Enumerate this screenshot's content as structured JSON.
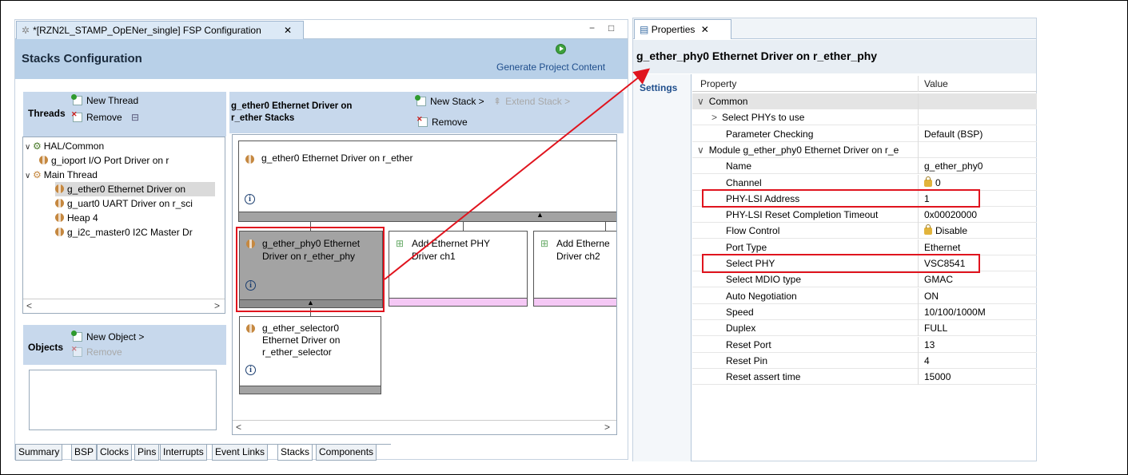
{
  "editor": {
    "tab_title": "*[RZN2L_STAMP_OpENer_single] FSP Configuration",
    "close_glyph": "✕",
    "minimize_glyph": "−",
    "maximize_glyph": "□",
    "header_title": "Stacks Configuration",
    "generate_label": "Generate Project Content"
  },
  "threads": {
    "label": "Threads",
    "new_thread": "New Thread",
    "remove": "Remove",
    "tree": [
      {
        "label": "HAL/Common",
        "level": 0,
        "expanded": true
      },
      {
        "label": "g_ioport I/O Port Driver on r",
        "level": 1
      },
      {
        "label": "Main Thread",
        "level": 0,
        "expanded": true
      },
      {
        "label": "g_ether0 Ethernet Driver on",
        "level": 1,
        "selected": true
      },
      {
        "label": "g_uart0 UART Driver on r_sci",
        "level": 1
      },
      {
        "label": "Heap 4",
        "level": 1
      },
      {
        "label": "g_i2c_master0 I2C Master Dr",
        "level": 1
      }
    ]
  },
  "objects": {
    "label": "Objects",
    "new_object": "New Object >",
    "remove": "Remove"
  },
  "stacks": {
    "title_line1": "g_ether0 Ethernet Driver on",
    "title_line2": "r_ether Stacks",
    "new_stack": "New Stack >",
    "extend_stack": "Extend Stack >",
    "remove": "Remove",
    "root_block": "g_ether0 Ethernet Driver on r_ether",
    "phy_block_line1": "g_ether_phy0 Ethernet",
    "phy_block_line2": "Driver on r_ether_phy",
    "add_ch1_line1": "Add Ethernet PHY",
    "add_ch1_line2": "Driver ch1",
    "add_ch2_line1": "Add Etherne",
    "add_ch2_line2": "Driver ch2",
    "selector_line1": "g_ether_selector0",
    "selector_line2": "Ethernet Driver on",
    "selector_line3": "r_ether_selector",
    "info_glyph": "i"
  },
  "bottom_tabs": [
    "Summary",
    "BSP",
    "Clocks",
    "Pins",
    "Interrupts",
    "Event Links",
    "Stacks",
    "Components"
  ],
  "properties": {
    "tab_label": "Properties",
    "close_glyph": "✕",
    "title": "g_ether_phy0 Ethernet Driver on r_ether_phy",
    "side_tab": "Settings",
    "col_property": "Property",
    "col_value": "Value",
    "rows": [
      {
        "name": "Common",
        "value": "",
        "indent": 0,
        "chev": "∨",
        "group": true
      },
      {
        "name": "Select PHYs to use",
        "value": "",
        "indent": 1,
        "chev": ">"
      },
      {
        "name": "Parameter Checking",
        "value": "Default (BSP)",
        "indent": 2
      },
      {
        "name": "Module g_ether_phy0 Ethernet Driver on r_e",
        "value": "",
        "indent": 0,
        "chev": "∨"
      },
      {
        "name": "Name",
        "value": "g_ether_phy0",
        "indent": 2
      },
      {
        "name": "Channel",
        "value": "0",
        "indent": 2,
        "lock": true
      },
      {
        "name": "PHY-LSI Address",
        "value": "1",
        "indent": 2
      },
      {
        "name": "PHY-LSI Reset Completion Timeout",
        "value": "0x00020000",
        "indent": 2
      },
      {
        "name": "Flow Control",
        "value": "Disable",
        "indent": 2,
        "lock": true
      },
      {
        "name": "Port Type",
        "value": "Ethernet",
        "indent": 2
      },
      {
        "name": "Select PHY",
        "value": "VSC8541",
        "indent": 2
      },
      {
        "name": "Select MDIO type",
        "value": "GMAC",
        "indent": 2
      },
      {
        "name": "Auto Negotiation",
        "value": "ON",
        "indent": 2
      },
      {
        "name": "Speed",
        "value": "10/100/1000M",
        "indent": 2
      },
      {
        "name": "Duplex",
        "value": "FULL",
        "indent": 2
      },
      {
        "name": "Reset Port",
        "value": "13",
        "indent": 2
      },
      {
        "name": "Reset Pin",
        "value": "4",
        "indent": 2
      },
      {
        "name": "Reset assert time",
        "value": "15000",
        "indent": 2
      }
    ]
  },
  "colors": {
    "highlight": "#e0141e",
    "accent": "#1f4e8c",
    "header_bg": "#b8d0e8"
  }
}
